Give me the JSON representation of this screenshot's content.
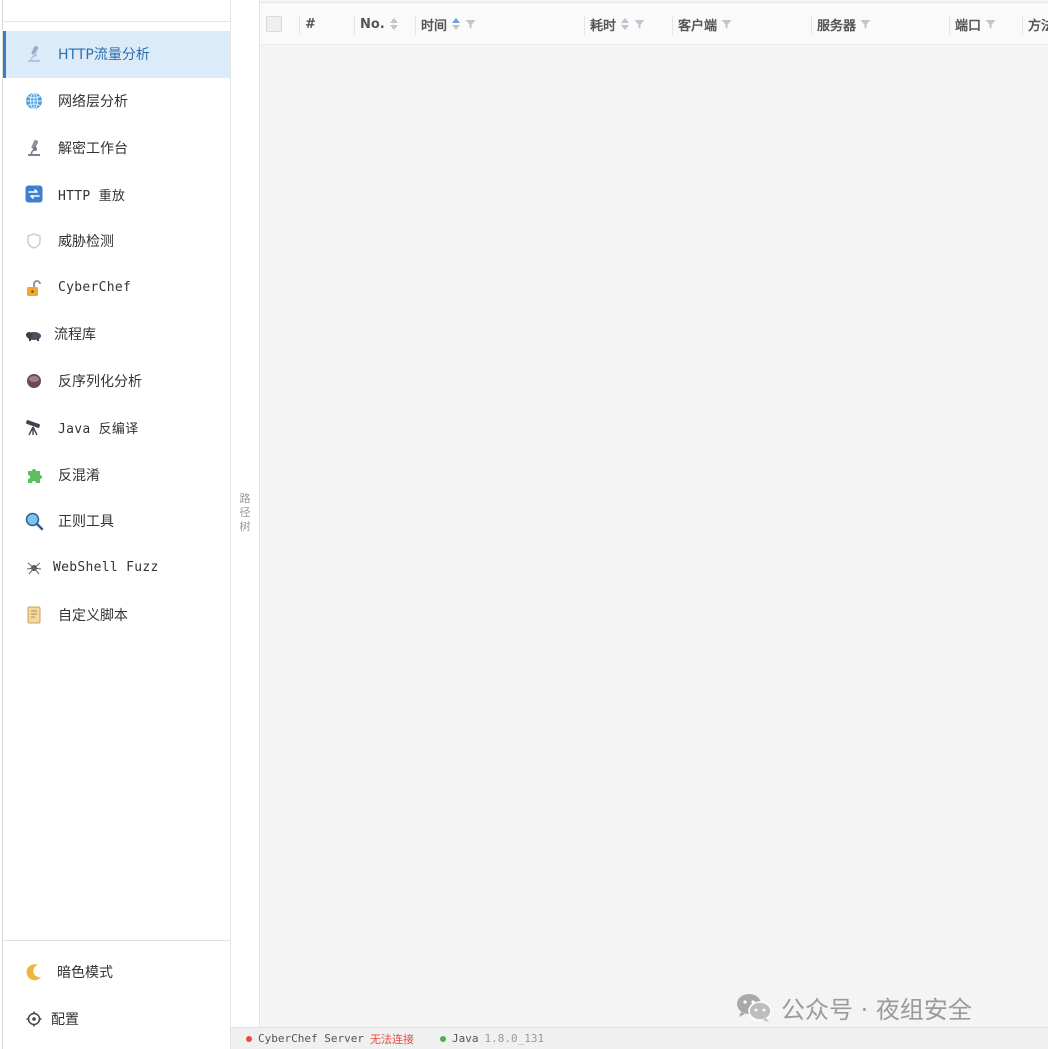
{
  "sidebar": {
    "items": [
      {
        "label": "HTTP流量分析",
        "icon": "microscope-icon",
        "mono": false,
        "active": true
      },
      {
        "label": "网络层分析",
        "icon": "globe-icon",
        "mono": false,
        "active": false
      },
      {
        "label": "解密工作台",
        "icon": "microscope-icon",
        "mono": false,
        "active": false
      },
      {
        "label": "HTTP 重放",
        "icon": "repeat-icon",
        "mono": false,
        "active": false
      },
      {
        "label": "威胁检测",
        "icon": "shield-icon",
        "mono": false,
        "active": false
      },
      {
        "label": "CyberChef",
        "icon": "unlock-icon",
        "mono": true,
        "active": false
      },
      {
        "label": "流程库",
        "icon": "bison-icon",
        "mono": false,
        "active": false
      },
      {
        "label": "反序列化分析",
        "icon": "bowl-icon",
        "mono": false,
        "active": false
      },
      {
        "label": "Java 反编译",
        "icon": "telescope-icon",
        "mono": false,
        "active": false
      },
      {
        "label": "反混淆",
        "icon": "puzzle-icon",
        "mono": false,
        "active": false
      },
      {
        "label": "正则工具",
        "icon": "magnifier-icon",
        "mono": false,
        "active": false
      },
      {
        "label": "WebShell Fuzz",
        "icon": "spider-icon",
        "mono": true,
        "active": false
      },
      {
        "label": "自定义脚本",
        "icon": "scroll-icon",
        "mono": false,
        "active": false
      }
    ],
    "bottom": {
      "dark_mode_label": "暗色模式",
      "settings_label": "配置"
    }
  },
  "path_tree": {
    "label": "路径树"
  },
  "table": {
    "columns": [
      {
        "label": "#",
        "sortable": false,
        "filterable": false
      },
      {
        "label": "No.",
        "sortable": true,
        "filterable": false
      },
      {
        "label": "时间",
        "sortable": true,
        "filterable": true
      },
      {
        "label": "耗时",
        "sortable": true,
        "filterable": true
      },
      {
        "label": "客户端",
        "sortable": false,
        "filterable": true
      },
      {
        "label": "服务器",
        "sortable": false,
        "filterable": true
      },
      {
        "label": "端口",
        "sortable": false,
        "filterable": true
      },
      {
        "label": "方法",
        "sortable": false,
        "filterable": false
      }
    ],
    "rows": []
  },
  "status_bar": {
    "cyberchef_label": "CyberChef Server",
    "cyberchef_status": "无法连接",
    "java_label": "Java",
    "java_version": "1.8.0_131"
  },
  "watermark": {
    "text": "公众号 · 夜组安全"
  },
  "colors": {
    "accent": "#3b7dc4",
    "active_bg": "#dcebf9",
    "error": "#e74c3c",
    "ok": "#4caf50"
  }
}
